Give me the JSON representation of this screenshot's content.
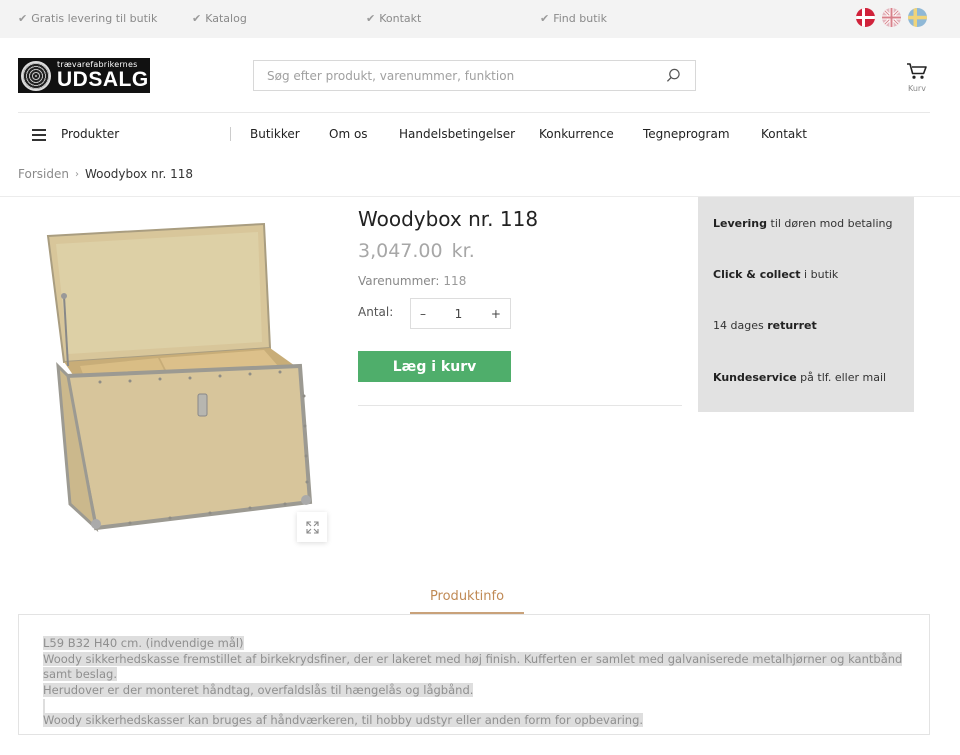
{
  "topbar": {
    "usps": [
      "Gratis levering til butik",
      "Katalog",
      "Kontakt",
      "Find butik"
    ],
    "languages": [
      "danish-flag-icon",
      "uk-flag-icon",
      "swedish-flag-icon"
    ]
  },
  "header": {
    "logo_small": "trævarefabrikernes",
    "logo_big": "UDSALG",
    "search_placeholder": "Søg efter produkt, varenummer, funktion",
    "cart_label": "Kurv"
  },
  "nav": {
    "products_label": "Produkter",
    "items": [
      "Butikker",
      "Om os",
      "Handelsbetingelser",
      "Konkurrence",
      "Tegneprogram",
      "Kontakt"
    ]
  },
  "breadcrumb": {
    "home": "Forsiden",
    "current": "Woodybox nr. 118"
  },
  "product": {
    "title": "Woodybox nr. 118",
    "price": "3,047.00 kr.",
    "sku_label": "Varenummer:",
    "sku_value": "118",
    "qty_label": "Antal:",
    "qty_minus": "–",
    "qty_value": "1",
    "qty_plus": "+",
    "add_to_cart": "Læg i kurv"
  },
  "service": [
    {
      "bold": "Levering",
      "rest": " til døren mod betaling"
    },
    {
      "bold": "Click & collect",
      "rest": " i butik"
    },
    {
      "pre": "14 dages ",
      "bold": "returret"
    },
    {
      "bold": "Kundeservice",
      "rest": " på tlf. eller mail"
    }
  ],
  "tabs": {
    "active": "Produktinfo"
  },
  "description": {
    "line1": "L59 B32 H40 cm. (indvendige mål)",
    "line2": "Woody sikkerhedskasse fremstillet af birkekrydsfiner, der er lakeret med høj finish. Kufferten er samlet med galvaniserede metalhjørner og kantbånd samt beslag.",
    "line3": "Herudover er der monteret håndtag, overfaldslås til hængelås og lågbånd.",
    "line4": "Woody sikkerhedskasser kan bruges af håndværkeren, til hobby udstyr eller anden form for opbevaring."
  },
  "colors": {
    "accent_green": "#4fae6b",
    "tab_accent": "#c08a55",
    "service_bg": "#e2e2e2",
    "topbar_bg": "#f3f3f3"
  }
}
